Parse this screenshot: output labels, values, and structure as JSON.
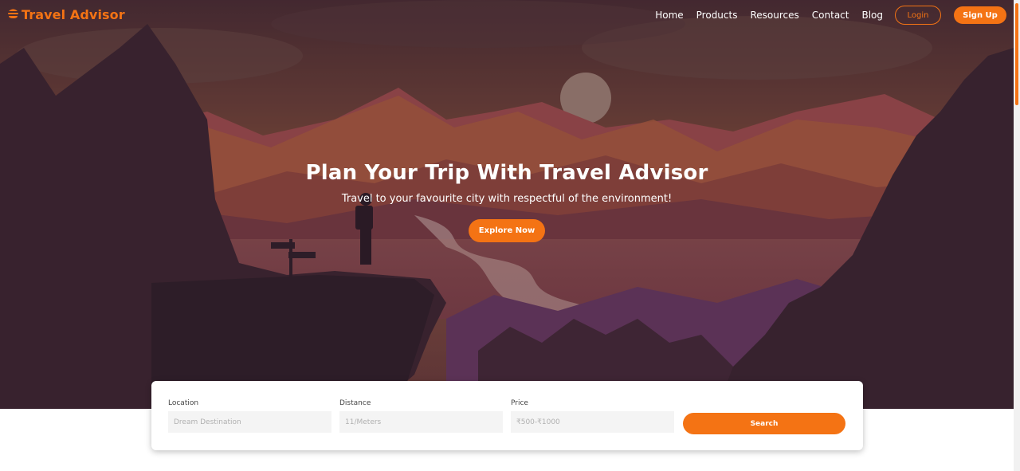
{
  "brand": {
    "name": "Travel Advisor",
    "accent": "#f47314"
  },
  "nav": {
    "links": [
      "Home",
      "Products",
      "Resources",
      "Contact",
      "Blog"
    ],
    "login_label": "Login",
    "signup_label": "Sign Up"
  },
  "hero": {
    "title": "Plan Your Trip With Travel Advisor",
    "subtitle": "Travel to your favourite city with respectful of the environment!",
    "cta_label": "Explore Now"
  },
  "search": {
    "fields": [
      {
        "label": "Location",
        "placeholder": "Dream Destination"
      },
      {
        "label": "Distance",
        "placeholder": "11/Meters"
      },
      {
        "label": "Price",
        "placeholder": "₹500-₹1000"
      }
    ],
    "button_label": "Search"
  },
  "icons": {
    "logo": "burger-stack-icon"
  }
}
